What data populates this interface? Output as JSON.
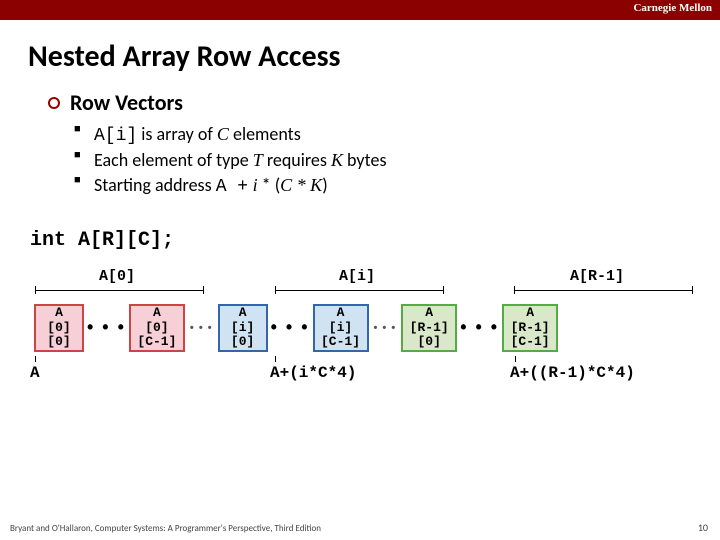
{
  "brand": "Carnegie Mellon",
  "title": "Nested Array Row Access",
  "subtitle": "Row Vectors",
  "bullets": {
    "b1a": "A[i]",
    "b1b": " is array of ",
    "b1c": "C",
    "b1d": " elements",
    "b2a": "Each element of type ",
    "b2b": "T",
    "b2c": " requires ",
    "b2d": "K",
    "b2e": " bytes",
    "b3a": "Starting address ",
    "b3b": "A +",
    "b3c": " i",
    "b3d": " * (",
    "b3e": "C * K",
    "b3f": ")"
  },
  "declaration": "int A[R][C];",
  "rowLabels": {
    "l0": "A[0]",
    "l1": "A[i]",
    "l2": "A[R-1]"
  },
  "cells": {
    "c00": "A\n[0]\n[0]",
    "c01": "A\n[0]\n[C-1]",
    "c10": "A\n[i]\n[0]",
    "c11": "A\n[i]\n[C-1]",
    "c20": "A\n[R-1]\n[0]",
    "c21": "A\n[R-1]\n[C-1]"
  },
  "addrs": {
    "a0": "A",
    "a1": "A+(i*C*4)",
    "a2": "A+((R-1)*C*4)"
  },
  "dots": "•  •  •",
  "footer": "Bryant and O'Hallaron, Computer Systems: A Programmer's Perspective, Third Edition",
  "page": "10",
  "colors": {
    "pink": "#f7cfd6",
    "blue": "#cfe3f2",
    "green": "#d8e8c8"
  }
}
